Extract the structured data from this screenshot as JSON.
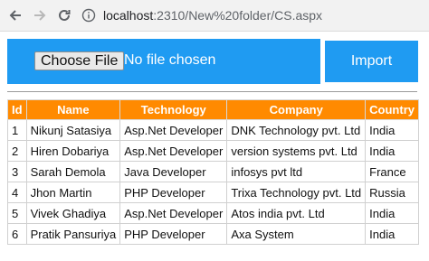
{
  "browser": {
    "back_icon": "arrow-left-icon",
    "forward_icon": "arrow-right-icon",
    "reload_icon": "reload-icon",
    "info_icon": "info-icon",
    "url_host": "localhost",
    "url_path": ":2310/New%20folder/CS.aspx"
  },
  "upload": {
    "choose_label": "Choose File",
    "status": "No file chosen",
    "import_label": "Import",
    "panel_color": "#1f9bf2"
  },
  "table": {
    "header_color": "#ff8a00",
    "columns": [
      "Id",
      "Name",
      "Technology",
      "Company",
      "Country"
    ],
    "rows": [
      [
        "1",
        "Nikunj Satasiya",
        "Asp.Net Developer",
        "DNK Technology pvt. Ltd",
        "India"
      ],
      [
        "2",
        "Hiren Dobariya",
        "Asp.Net Developer",
        "version systems pvt. Ltd",
        "India"
      ],
      [
        "3",
        "Sarah Demola",
        "Java Developer",
        "infosys pvt ltd",
        "France"
      ],
      [
        "4",
        "Jhon Martin",
        "PHP Developer",
        "Trixa Technology pvt. Ltd",
        "Russia"
      ],
      [
        "5",
        "Vivek Ghadiya",
        "Asp.Net Developer",
        "Atos india pvt. Ltd",
        "India"
      ],
      [
        "6",
        "Pratik Pansuriya",
        "PHP Developer",
        "Axa System",
        "India"
      ]
    ]
  }
}
